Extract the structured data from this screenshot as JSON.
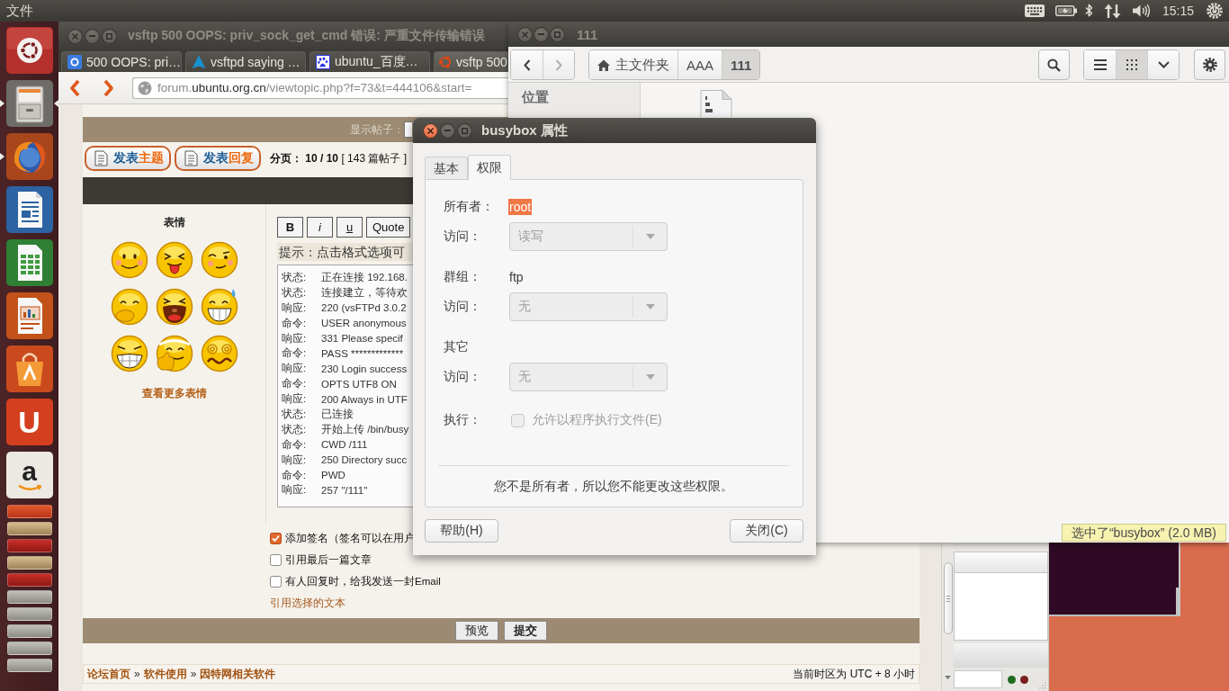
{
  "top_panel": {
    "menu": "文件",
    "indicators": [
      {
        "kind": "keyboard"
      },
      {
        "kind": "battery"
      },
      {
        "kind": "bluetooth"
      },
      {
        "kind": "network"
      },
      {
        "kind": "volume"
      }
    ],
    "clock": "15:15"
  },
  "launcher": {
    "items": [
      {
        "kind": "dash",
        "running": false,
        "active": false
      },
      {
        "kind": "files",
        "running": true,
        "active": true
      },
      {
        "kind": "browser",
        "running": true,
        "active": false
      },
      {
        "kind": "writer",
        "running": false,
        "active": false
      },
      {
        "kind": "calc",
        "running": false,
        "active": false
      },
      {
        "kind": "impress",
        "running": false,
        "active": false
      },
      {
        "kind": "store",
        "running": false,
        "active": false
      },
      {
        "kind": "letter",
        "glyph": "U",
        "running": false,
        "active": false
      },
      {
        "kind": "letter-light",
        "glyph": "a",
        "running": false,
        "active": false
      }
    ],
    "folded": [
      {
        "kind": "ubuntu-one"
      },
      {
        "kind": "archive"
      },
      {
        "kind": "filezilla"
      },
      {
        "kind": "archive"
      },
      {
        "kind": "filezilla"
      },
      {
        "kind": "plain"
      },
      {
        "kind": "plain"
      },
      {
        "kind": "plain"
      },
      {
        "kind": "plain"
      },
      {
        "kind": "plain"
      }
    ]
  },
  "browser": {
    "title": "vsftp 500 OOPS: priv_sock_get_cmd 错误: 严重文件传输错误",
    "tabs": [
      {
        "title": "500 OOPS: pri…",
        "kind": "tile",
        "selected": false
      },
      {
        "title": "vsftpd saying …",
        "kind": "triangle",
        "selected": false
      },
      {
        "title": "ubuntu_百度…",
        "kind": "paw",
        "selected": false
      },
      {
        "title": "vsftp 500",
        "kind": "ring",
        "selected": true
      }
    ],
    "url": {
      "prefix": "forum.",
      "domain": "ubuntu.org.cn",
      "path": "/viewtopic.php?f=73&t=444106&start="
    },
    "page": {
      "display_label": "显示帖子：",
      "post_buttons": [
        {
          "lead": "发表",
          "accent": "主题"
        },
        {
          "lead": "发表",
          "accent": "回复"
        }
      ],
      "pagination": "**分页：** **10 / 10** [ 143 篇帖子 ]",
      "smilies_title": "表情",
      "smilies": [
        {
          "kind": "blush"
        },
        {
          "kind": "tongue"
        },
        {
          "kind": "wink"
        },
        {
          "kind": "giggle"
        },
        {
          "kind": "laugh"
        },
        {
          "kind": "sweat"
        },
        {
          "kind": "grin"
        },
        {
          "kind": "thumbs"
        },
        {
          "kind": "dizzy"
        }
      ],
      "more_smilies": "查看更多表情",
      "format_buttons": [
        {
          "label": "B",
          "kind": "bold"
        },
        {
          "label": "i",
          "kind": "italic"
        },
        {
          "label": "u",
          "kind": "underline"
        },
        {
          "label": "Quote",
          "kind": "plain"
        }
      ],
      "hint": "提示：点击格式选项可",
      "log": [
        {
          "tag": "状态:",
          "text": "正在连接 192.168."
        },
        {
          "tag": "状态:",
          "text": "连接建立，等待欢"
        },
        {
          "tag": "响应:",
          "text": "220 (vsFTPd 3.0.2"
        },
        {
          "tag": "命令:",
          "text": "USER anonymous"
        },
        {
          "tag": "响应:",
          "text": "331 Please specif"
        },
        {
          "tag": "命令:",
          "text": "PASS *************"
        },
        {
          "tag": "响应:",
          "text": "230 Login success"
        },
        {
          "tag": "命令:",
          "text": "OPTS UTF8 ON"
        },
        {
          "tag": "响应:",
          "text": "200 Always in UTF"
        },
        {
          "tag": "状态:",
          "text": "已连接"
        },
        {
          "tag": "状态:",
          "text": "开始上传 /bin/busy"
        },
        {
          "tag": "命令:",
          "text": "CWD /111"
        },
        {
          "tag": "响应:",
          "text": "250 Directory succ"
        },
        {
          "tag": "命令:",
          "text": "PWD"
        },
        {
          "tag": "响应:",
          "text": "257 \"/111\""
        }
      ],
      "options": [
        {
          "label": "添加签名（签名可以在用户",
          "checked": true
        },
        {
          "label": "引用最后一篇文章",
          "checked": false
        },
        {
          "label": "有人回复时，给我发送一封Email",
          "checked": false
        }
      ],
      "quote_link": "引用选择的文本",
      "form_buttons": [
        {
          "label": "预览",
          "kind": "normal"
        },
        {
          "label": "提交",
          "kind": "primary"
        }
      ],
      "breadcrumb": [
        {
          "kind": "link",
          "text": "论坛首页"
        },
        {
          "kind": "separator",
          "text": "»"
        },
        {
          "kind": "link",
          "text": "软件使用"
        },
        {
          "kind": "separator",
          "text": "»"
        },
        {
          "kind": "link",
          "text": "因特网相关软件"
        }
      ],
      "timezone": "当前时区为 UTC + 8 小时"
    }
  },
  "filezilla": {
    "leds": [
      {
        "color": "#1f6b1f"
      },
      {
        "color": "#7b1e1e"
      }
    ]
  },
  "file_manager": {
    "title": "111",
    "nav": [
      {
        "kind": "back",
        "disabled": false
      },
      {
        "kind": "forward",
        "disabled": true
      }
    ],
    "path": [
      {
        "kind": "home",
        "label": "主文件夹",
        "selected": false
      },
      {
        "kind": "folder",
        "label": "AAA",
        "selected": false
      },
      {
        "kind": "folder",
        "label": "111",
        "selected": true
      }
    ],
    "views": [
      {
        "kind": "list",
        "selected": false
      },
      {
        "kind": "grid",
        "selected": true
      }
    ],
    "sidebar_heading": "位置",
    "status": "选中了“busybox” (2.0 MB)"
  },
  "dialog": {
    "title": "busybox 属性",
    "tabs": [
      {
        "label": "基本",
        "selected": false
      },
      {
        "label": "权限",
        "selected": true
      }
    ],
    "rows": [
      {
        "kind": "value",
        "label": "所有者：",
        "value": "root",
        "selected": true
      },
      {
        "kind": "combo",
        "label": "访问：",
        "value": "读写",
        "disabled": true
      },
      {
        "kind": "value",
        "label": "群组：",
        "value": "ftp",
        "selected": false
      },
      {
        "kind": "combo",
        "label": "访问：",
        "value": "无",
        "disabled": true
      },
      {
        "kind": "heading",
        "label": "其它"
      },
      {
        "kind": "combo",
        "label": "访问：",
        "value": "无",
        "disabled": true
      },
      {
        "kind": "check",
        "label": "执行：",
        "text": "允许以程序执行文件(E)",
        "checked": false,
        "disabled": true
      }
    ],
    "note": "您不是所有者，所以您不能更改这些权限。",
    "buttons": [
      {
        "label": "帮助(H)"
      },
      {
        "label": "关闭(C)"
      }
    ]
  }
}
